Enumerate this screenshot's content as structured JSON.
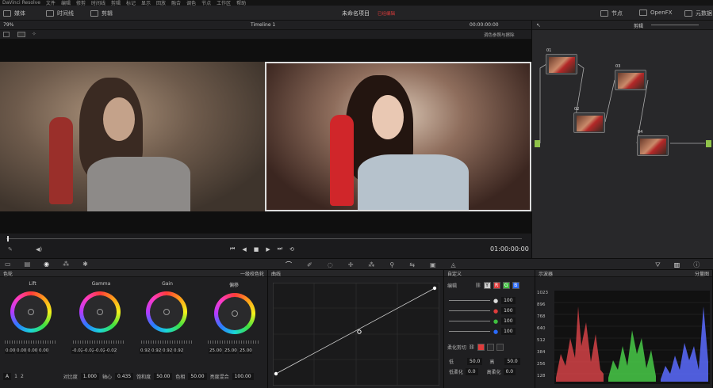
{
  "app": {
    "name": "DaVinci Resolve"
  },
  "menu": [
    "文件",
    "编辑",
    "修剪",
    "时间线",
    "剪辑",
    "标记",
    "显示",
    "回放",
    "融合",
    "调色",
    "节点",
    "工作区",
    "帮助"
  ],
  "titlebar": {
    "left": [
      {
        "label": "媒体"
      },
      {
        "label": "时间线"
      },
      {
        "label": "剪辑"
      }
    ],
    "project": "未命名项目",
    "status": "已经编辑",
    "right": [
      {
        "label": "节点"
      },
      {
        "label": "OpenFX"
      },
      {
        "label": "元数据"
      }
    ]
  },
  "viewer_bar": {
    "zoom": "79%",
    "timeline": "Timeline 1",
    "timecode": "00:00:00:00",
    "node_label": "剪辑",
    "mode": "调色参照与擦除"
  },
  "playback": {
    "timecode": "01:00:00:00"
  },
  "node_graph": {
    "nodes": [
      {
        "id": "01"
      },
      {
        "id": "02"
      },
      {
        "id": "03"
      },
      {
        "id": "04"
      }
    ]
  },
  "wheels_panel": {
    "title": "色轮",
    "mode": "一级校色轮",
    "wheels": [
      {
        "name": "Lift",
        "values": [
          "0.00",
          "0.00",
          "0.00",
          "0.00"
        ],
        "channels": [
          "Y",
          "R",
          "G",
          "B"
        ]
      },
      {
        "name": "Gamma",
        "values": [
          "-0.02",
          "-0.02",
          "-0.02",
          "-0.02"
        ],
        "channels": [
          "Y",
          "R",
          "G",
          "B"
        ]
      },
      {
        "name": "Gain",
        "values": [
          "0.92",
          "0.92",
          "0.92",
          "0.92"
        ],
        "channels": [
          "Y",
          "R",
          "G",
          "B"
        ]
      },
      {
        "name": "偏移",
        "values": [
          "25.00",
          "25.00",
          "25.00",
          "25.00"
        ],
        "channels": [
          "R",
          "G",
          "B"
        ]
      }
    ],
    "bottom": {
      "page_a": "A",
      "page1": "1",
      "page2": "2",
      "contrast_label": "对比度",
      "contrast": "1.000",
      "pivot_label": "轴心",
      "pivot": "0.435",
      "sat_label": "饱和度",
      "sat": "50.00",
      "hue_label": "色相",
      "hue": "50.00",
      "lum_mix_label": "亮度混合",
      "lum_mix": "100.00"
    }
  },
  "curves_panel": {
    "title": "曲线",
    "mode": "自定义"
  },
  "edit_panel": {
    "title": "编辑",
    "channels": [
      "Y",
      "R",
      "G",
      "B"
    ],
    "sliders": [
      {
        "label": "100"
      },
      {
        "label": "100"
      },
      {
        "label": "100"
      },
      {
        "label": "100"
      }
    ],
    "soft_clip": "柔化剪切",
    "low_label": "低",
    "low": "50.0",
    "high_label": "高",
    "high": "50.0",
    "ls_label": "低柔化",
    "ls": "0.0",
    "hs_label": "高柔化",
    "hs": "0.0"
  },
  "scope_panel": {
    "title": "示波器",
    "mode": "分量图",
    "ticks": [
      "1023",
      "896",
      "768",
      "640",
      "512",
      "384",
      "256",
      "128"
    ]
  },
  "colors": {
    "accent": "#e03c3c",
    "node_border": "#cfcf3a"
  }
}
